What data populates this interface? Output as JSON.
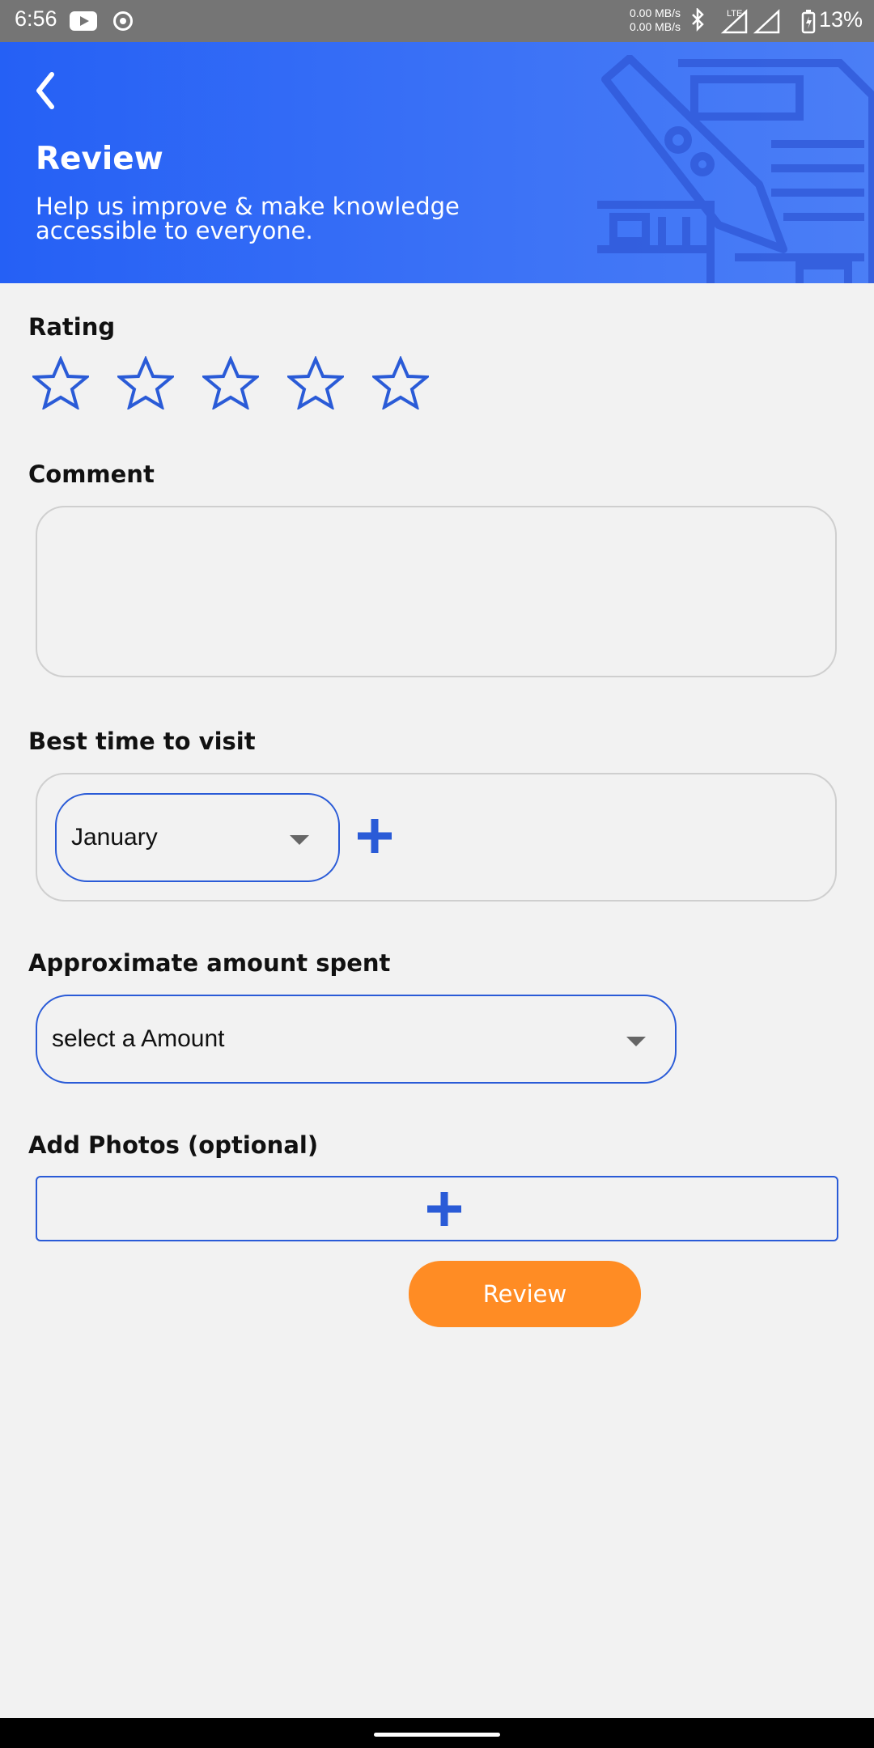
{
  "status_bar": {
    "time": "6:56",
    "net_up": "0.00 MB/s",
    "net_down": "0.00 MB/s",
    "network_type": "LTE",
    "battery": "13%"
  },
  "header": {
    "title": "Review",
    "subtitle": "Help us improve & make knowledge accessible to everyone."
  },
  "rating": {
    "label": "Rating",
    "stars": 5,
    "selected": 0
  },
  "comment": {
    "label": "Comment",
    "value": ""
  },
  "best_time": {
    "label": "Best time to visit",
    "selected": "January"
  },
  "amount": {
    "label": "Approximate amount spent",
    "placeholder": "select a Amount"
  },
  "photos": {
    "label": "Add Photos (optional)"
  },
  "actions": {
    "review": "Review"
  },
  "colors": {
    "primary": "#2560f5",
    "accent": "#ff8c24",
    "background": "#f2f2f2"
  }
}
